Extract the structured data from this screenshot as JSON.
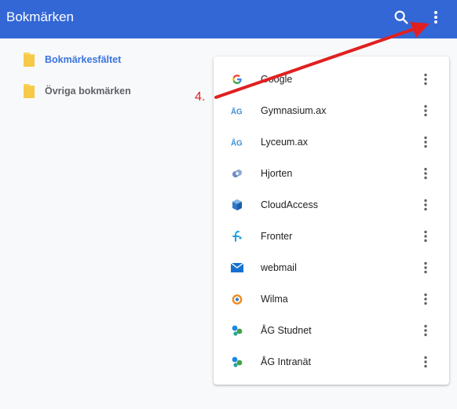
{
  "header": {
    "title": "Bokmärken",
    "icons": {
      "search": "search-icon",
      "menu": "more-vert-icon"
    },
    "color": "#3367d6"
  },
  "sidebar": {
    "items": [
      {
        "label": "Bokmärkesfältet",
        "icon": "folder-icon",
        "selected": true
      },
      {
        "label": "Övriga bokmärken",
        "icon": "folder-icon",
        "selected": false
      }
    ]
  },
  "bookmarks": [
    {
      "name": "Google",
      "favicon": "google-icon"
    },
    {
      "name": "Gymnasium.ax",
      "favicon": "ag-icon"
    },
    {
      "name": "Lyceum.ax",
      "favicon": "ag-icon"
    },
    {
      "name": "Hjorten",
      "favicon": "hjorten-icon"
    },
    {
      "name": "CloudAccess",
      "favicon": "cloudaccess-icon"
    },
    {
      "name": "Fronter",
      "favicon": "fronter-icon"
    },
    {
      "name": "webmail",
      "favicon": "mail-icon"
    },
    {
      "name": "Wilma",
      "favicon": "wilma-icon"
    },
    {
      "name": "ÅG Studnet",
      "favicon": "studnet-icon"
    },
    {
      "name": "ÅG Intranät",
      "favicon": "intranet-icon"
    }
  ],
  "annotation": {
    "label": "4.",
    "color": "#e02020"
  }
}
